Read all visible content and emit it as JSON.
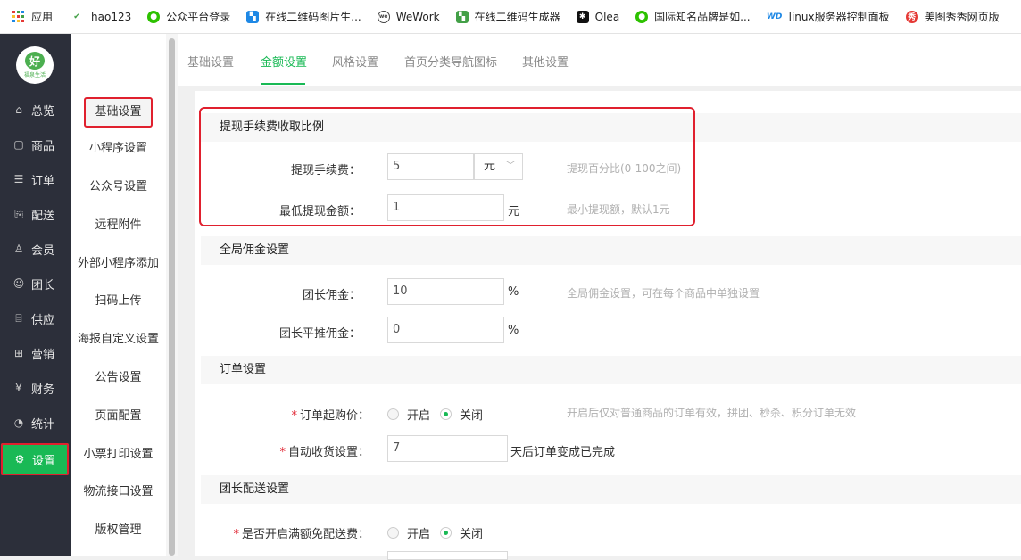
{
  "bookmarks": [
    {
      "label": "应用",
      "icon": "apps-grid-icon"
    },
    {
      "label": "hao123",
      "icon": "hao123-icon"
    },
    {
      "label": "公众平台登录",
      "icon": "wechat-icon"
    },
    {
      "label": "在线二维码图片生...",
      "icon": "qrcode-icon"
    },
    {
      "label": "WeWork",
      "icon": "wework-icon"
    },
    {
      "label": "在线二维码生成器",
      "icon": "qrcode-green-icon"
    },
    {
      "label": "Olea",
      "icon": "olea-icon"
    },
    {
      "label": "国际知名品牌是如...",
      "icon": "wechat-icon"
    },
    {
      "label": "linux服务器控制面板",
      "icon": "wdcp-icon"
    },
    {
      "label": "美图秀秀网页版",
      "icon": "meitu-icon"
    }
  ],
  "logo": {
    "mark": "好",
    "text": "福泉生活"
  },
  "leftnav": [
    {
      "label": "总览",
      "icon": "home-icon"
    },
    {
      "label": "商品",
      "icon": "goods-icon"
    },
    {
      "label": "订单",
      "icon": "order-icon"
    },
    {
      "label": "配送",
      "icon": "delivery-icon"
    },
    {
      "label": "会员",
      "icon": "member-icon"
    },
    {
      "label": "团长",
      "icon": "leader-icon"
    },
    {
      "label": "供应",
      "icon": "supply-icon"
    },
    {
      "label": "营销",
      "icon": "gift-icon"
    },
    {
      "label": "财务",
      "icon": "finance-icon"
    },
    {
      "label": "统计",
      "icon": "stats-icon"
    },
    {
      "label": "设置",
      "icon": "gear-icon"
    }
  ],
  "subnav": [
    "基础设置",
    "小程序设置",
    "公众号设置",
    "远程附件",
    "外部小程序添加",
    "扫码上传",
    "海报自定义设置",
    "公告设置",
    "页面配置",
    "小票打印设置",
    "物流接口设置",
    "版权管理"
  ],
  "tabs": [
    "基础设置",
    "金额设置",
    "风格设置",
    "首页分类导航图标",
    "其他设置"
  ],
  "withdraw": {
    "title": "提现手续费收取比例",
    "fee_label": "提现手续费：",
    "fee_value": "5",
    "fee_unit": "元",
    "fee_hint": "提现百分比(0-100之间)",
    "min_label": "最低提现金额：",
    "min_value": "1",
    "min_unit": "元",
    "min_hint": "最小提现额，默认1元"
  },
  "commission": {
    "title": "全局佣金设置",
    "leader_label": "团长佣金：",
    "leader_value": "10",
    "leader_unit": "%",
    "leader_hint": "全局佣金设置，可在每个商品中单独设置",
    "push_label": "团长平推佣金：",
    "push_value": "0",
    "push_unit": "%"
  },
  "order": {
    "title": "订单设置",
    "min_price_label": "订单起购价：",
    "opt_on": "开启",
    "opt_off": "关闭",
    "min_price_hint": "开启后仅对普通商品的订单有效，拼团、秒杀、积分订单无效",
    "auto_receive_label": "自动收货设置：",
    "auto_receive_value": "7",
    "auto_receive_suffix": "天后订单变成已完成"
  },
  "leader_delivery": {
    "title": "团长配送设置",
    "free_label": "是否开启满额免配送费：",
    "opt_on": "开启",
    "opt_off": "关闭"
  },
  "colors": {
    "accent": "#19b955",
    "highlight": "#e0202e",
    "sidebar": "#2c2f3a"
  }
}
